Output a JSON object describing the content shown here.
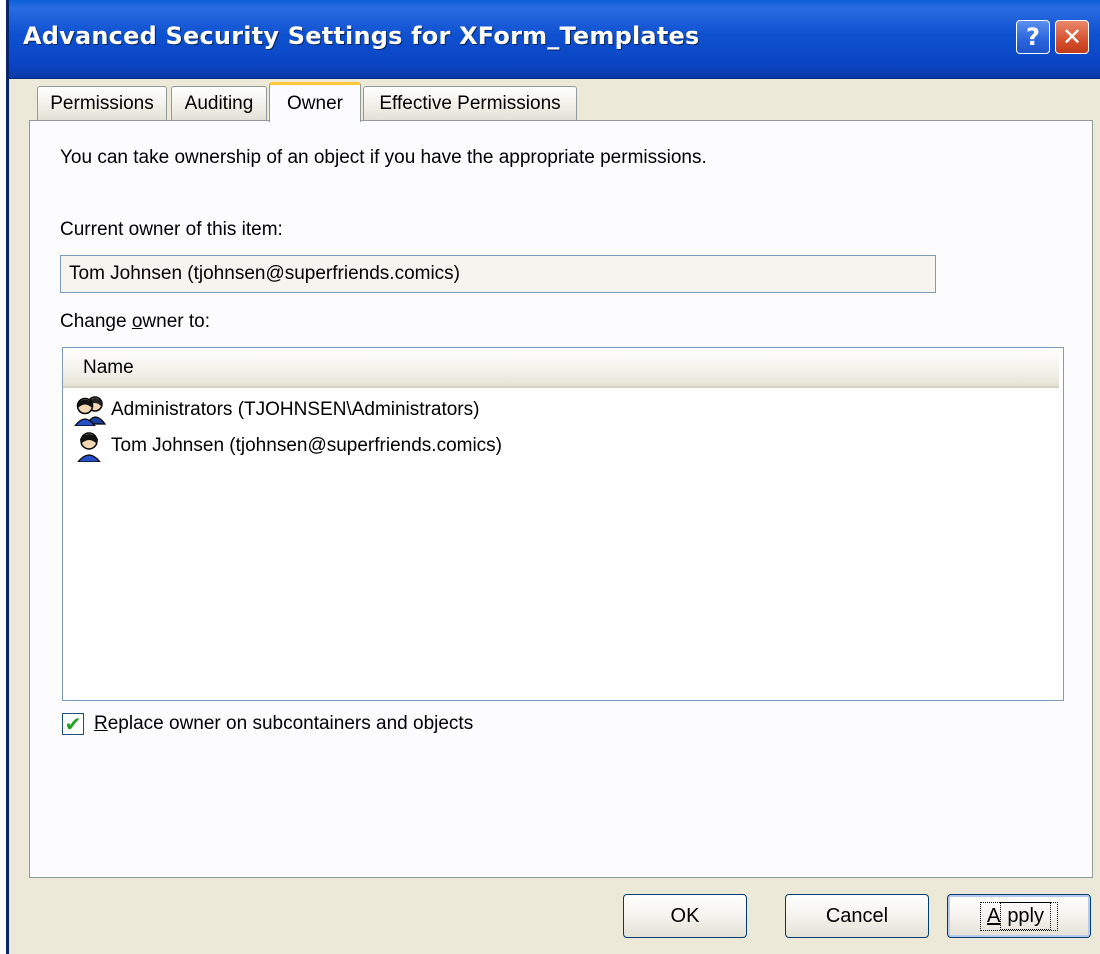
{
  "window": {
    "title": "Advanced Security Settings for XForm_Templates"
  },
  "titlebar": {
    "help_glyph": "?",
    "close_glyph": "✕"
  },
  "tabs": [
    {
      "label": "Permissions",
      "active": false
    },
    {
      "label": "Auditing",
      "active": false
    },
    {
      "label": "Owner",
      "active": true
    },
    {
      "label": "Effective Permissions",
      "active": false
    }
  ],
  "owner": {
    "intro": "You can take ownership of an object if you have the appropriate permissions.",
    "current_label": "Current owner of this item:",
    "current_value": "Tom Johnsen (tjohnsen@superfriends.comics)",
    "change_label_pre": "Change ",
    "change_label_key": "o",
    "change_label_post": "wner to:",
    "list_header": "Name",
    "list_items": [
      {
        "label": "Administrators (TJOHNSEN\\Administrators)",
        "icon": "group-users-icon"
      },
      {
        "label": "Tom Johnsen (tjohnsen@superfriends.comics)",
        "icon": "user-icon"
      }
    ],
    "replace_checkbox": {
      "key": "R",
      "rest": "eplace owner on subcontainers and objects",
      "checked": true
    }
  },
  "buttons": {
    "ok": "OK",
    "cancel": "Cancel",
    "apply_key": "A",
    "apply_rest": "pply"
  },
  "colors": {
    "titlebar": "#0a4fd0",
    "dialog_bg": "#ece9d8",
    "active_tab_accent": "#ffc83c",
    "check_mark": "#21a121"
  }
}
